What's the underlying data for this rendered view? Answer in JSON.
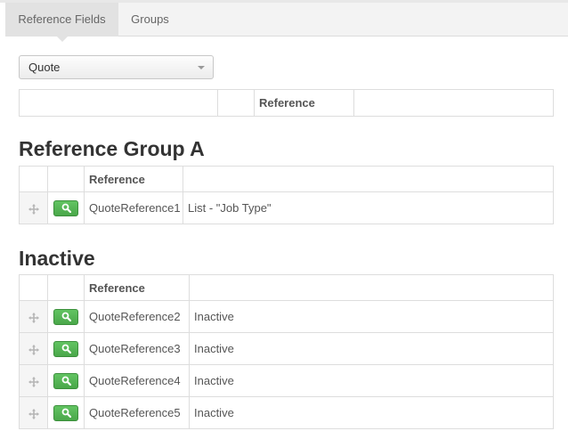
{
  "tabs": [
    {
      "label": "Reference Fields",
      "active": true
    },
    {
      "label": "Groups",
      "active": false
    }
  ],
  "entity_select": {
    "value": "Quote"
  },
  "top_table": {
    "header": [
      "",
      "",
      "Reference",
      ""
    ]
  },
  "groups": [
    {
      "title": "Reference Group A",
      "header": [
        "",
        "",
        "Reference",
        ""
      ],
      "rows": [
        {
          "reference": "QuoteReference1",
          "detail": "List - \"Job Type\""
        }
      ]
    },
    {
      "title": "Inactive",
      "header": [
        "",
        "",
        "Reference",
        ""
      ],
      "rows": [
        {
          "reference": "QuoteReference2",
          "detail": "Inactive"
        },
        {
          "reference": "QuoteReference3",
          "detail": "Inactive"
        },
        {
          "reference": "QuoteReference4",
          "detail": "Inactive"
        },
        {
          "reference": "QuoteReference5",
          "detail": "Inactive"
        }
      ]
    }
  ],
  "icons": {
    "move": "move-icon",
    "view": "search-icon"
  },
  "colors": {
    "view_button": "#5cb85c",
    "tab_active_bg": "#e2e2e2"
  }
}
